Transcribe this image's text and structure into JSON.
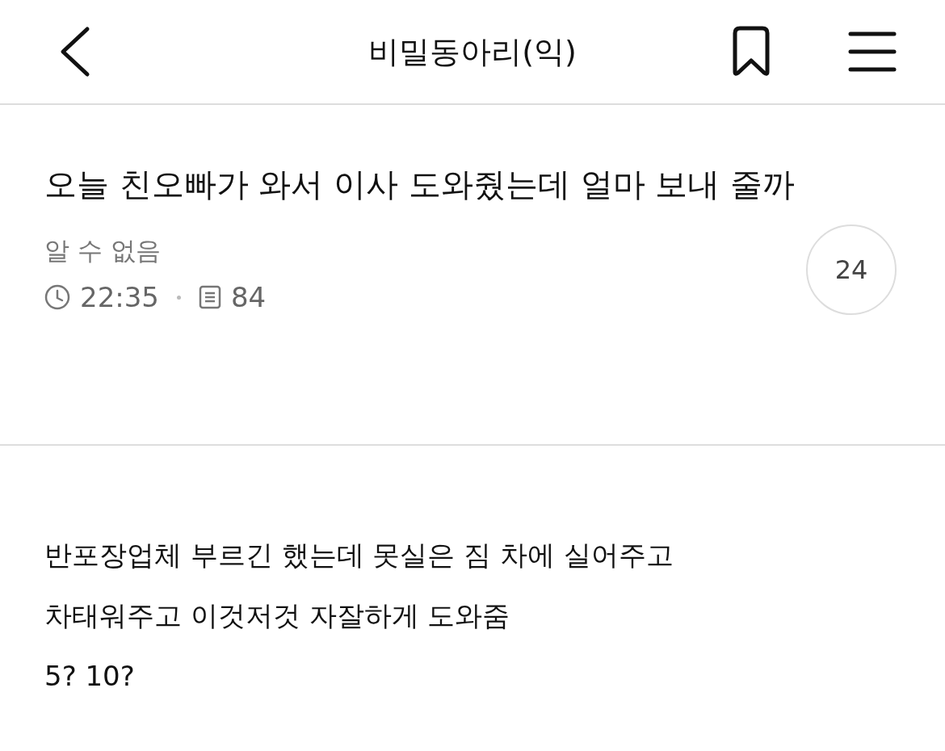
{
  "header": {
    "title": "비밀동아리(익)"
  },
  "post": {
    "title": "오늘 친오빠가 와서 이사 도와줬는데 얼마 보내 줄까",
    "author": "알 수 없음",
    "time": "22:35",
    "views": "84",
    "comment_count": "24"
  },
  "body": [
    "반포장업체 부르긴 했는데 못실은 짐 차에 실어주고",
    "차태워주고 이것저것 자잘하게 도와줌",
    "5? 10?"
  ]
}
